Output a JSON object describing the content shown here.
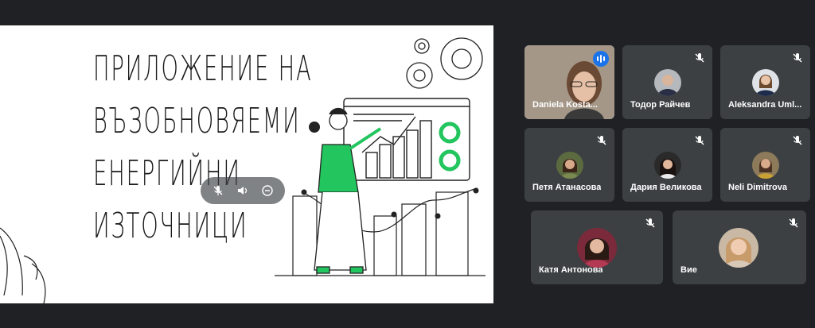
{
  "presentation": {
    "slide_title_lines": [
      "ПРИЛОЖЕНИЕ НА",
      "ВЪЗОБНОВЯЕМИ",
      "ЕНЕРГИЙНИ",
      "ИЗТОЧНИЦИ"
    ],
    "controls": [
      "mic-off",
      "volume",
      "minus-circle"
    ]
  },
  "participants": [
    {
      "name": "Daniela Kosta...",
      "speaking": true,
      "muted": false
    },
    {
      "name": "Тодор Райчев",
      "muted": true
    },
    {
      "name": "Aleksandra Uml...",
      "muted": true
    },
    {
      "name": "Петя Атанасова",
      "muted": true
    },
    {
      "name": "Дария Великова",
      "muted": true
    },
    {
      "name": "Neli Dimitrova",
      "muted": true
    },
    {
      "name": "Катя Антонова",
      "muted": true
    },
    {
      "name": "Вие",
      "muted": true
    }
  ],
  "colors": {
    "background": "#202124",
    "tile": "#3c4043",
    "accent_green": "#22c55e",
    "speaking_blue": "#1a73e8",
    "active_outline": "#8ab4f8"
  }
}
